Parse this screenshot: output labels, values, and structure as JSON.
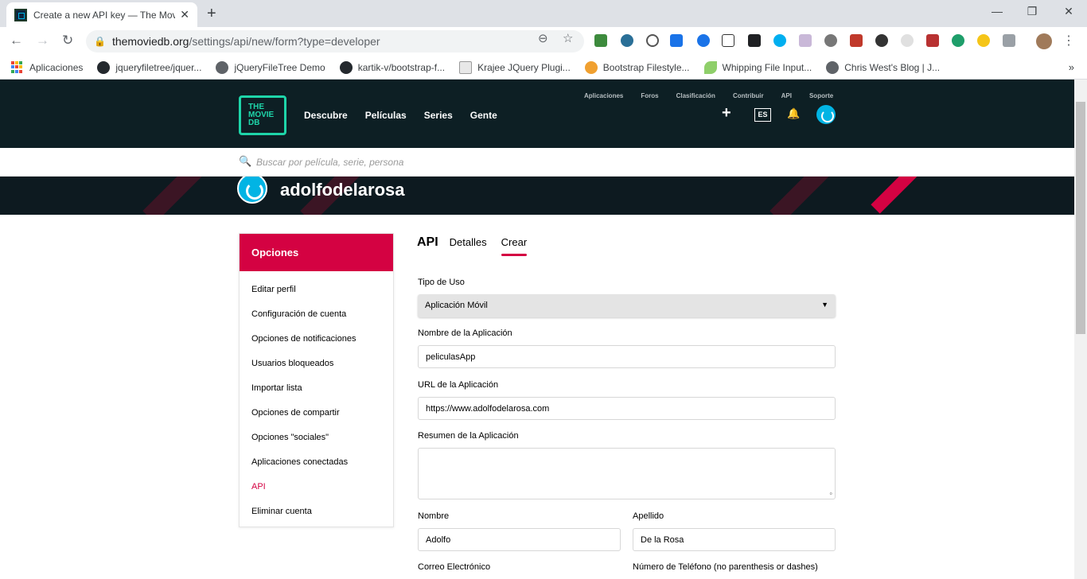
{
  "browser": {
    "tab_title": "Create a new API key — The Movie",
    "tab_close": "✕",
    "new_tab": "+",
    "window_controls": [
      "—",
      "❐",
      "✕"
    ],
    "nav": {
      "back": "←",
      "forward": "→",
      "reload": "↻"
    },
    "url_host": "themoviedb.org",
    "url_path": "/settings/api/new/form?type=developer",
    "zoom_icon": "⊖",
    "star_icon": "☆",
    "menu_icon": "⋮",
    "bookmarks": [
      {
        "label": "Aplicaciones",
        "icon": "apps-grid-icon"
      },
      {
        "label": "jqueryfiletree/jquer...",
        "icon": "github-icon"
      },
      {
        "label": "jQueryFileTree Demo",
        "icon": "globe-icon"
      },
      {
        "label": "kartik-v/bootstrap-f...",
        "icon": "github-icon"
      },
      {
        "label": "Krajee JQuery Plugi...",
        "icon": "krajee-icon"
      },
      {
        "label": "Bootstrap Filestyle...",
        "icon": "fruit-icon"
      },
      {
        "label": "Whipping File Input...",
        "icon": "leaf-icon"
      },
      {
        "label": "Chris West's Blog | J...",
        "icon": "globe-icon"
      }
    ],
    "bookmarks_more": "»"
  },
  "site": {
    "logo_lines": [
      "THE",
      "MOVIE",
      "DB"
    ],
    "main_nav": [
      "Descubre",
      "Películas",
      "Series",
      "Gente"
    ],
    "sub_nav": [
      "Aplicaciones",
      "Foros",
      "Clasificación",
      "Contribuir",
      "API",
      "Soporte"
    ],
    "add_icon": "+",
    "language": "ES",
    "bell_icon": "🔔",
    "search_placeholder": "Buscar por película, serie, persona",
    "username": "adolfodelarosa",
    "brand_color": "#d40242",
    "accent_color": "#01b4e4"
  },
  "sidebar": {
    "title": "Opciones",
    "items": [
      {
        "label": "Editar perfil"
      },
      {
        "label": "Configuración de cuenta"
      },
      {
        "label": "Opciones de notificaciones"
      },
      {
        "label": "Usuarios bloqueados"
      },
      {
        "label": "Importar lista"
      },
      {
        "label": "Opciones de compartir"
      },
      {
        "label": "Opciones \"sociales\""
      },
      {
        "label": "Aplicaciones conectadas"
      },
      {
        "label": "API"
      },
      {
        "label": "Eliminar cuenta"
      }
    ],
    "active_index": 8
  },
  "content": {
    "tabs": {
      "section": "API",
      "details": "Detalles",
      "create": "Crear"
    },
    "form": {
      "usage_type_label": "Tipo de Uso",
      "usage_type_value": "Aplicación Móvil",
      "app_name_label": "Nombre de la Aplicación",
      "app_name_value": "peliculasApp",
      "app_url_label": "URL de la Aplicación",
      "app_url_value": "https://www.adolfodelarosa.com",
      "app_summary_label": "Resumen de la Aplicación",
      "app_summary_value": "",
      "first_name_label": "Nombre",
      "first_name_value": "Adolfo",
      "last_name_label": "Apellido",
      "last_name_value": "De la Rosa",
      "email_label": "Correo Electrónico",
      "phone_label": "Número de Teléfono (no parenthesis or dashes)"
    }
  }
}
